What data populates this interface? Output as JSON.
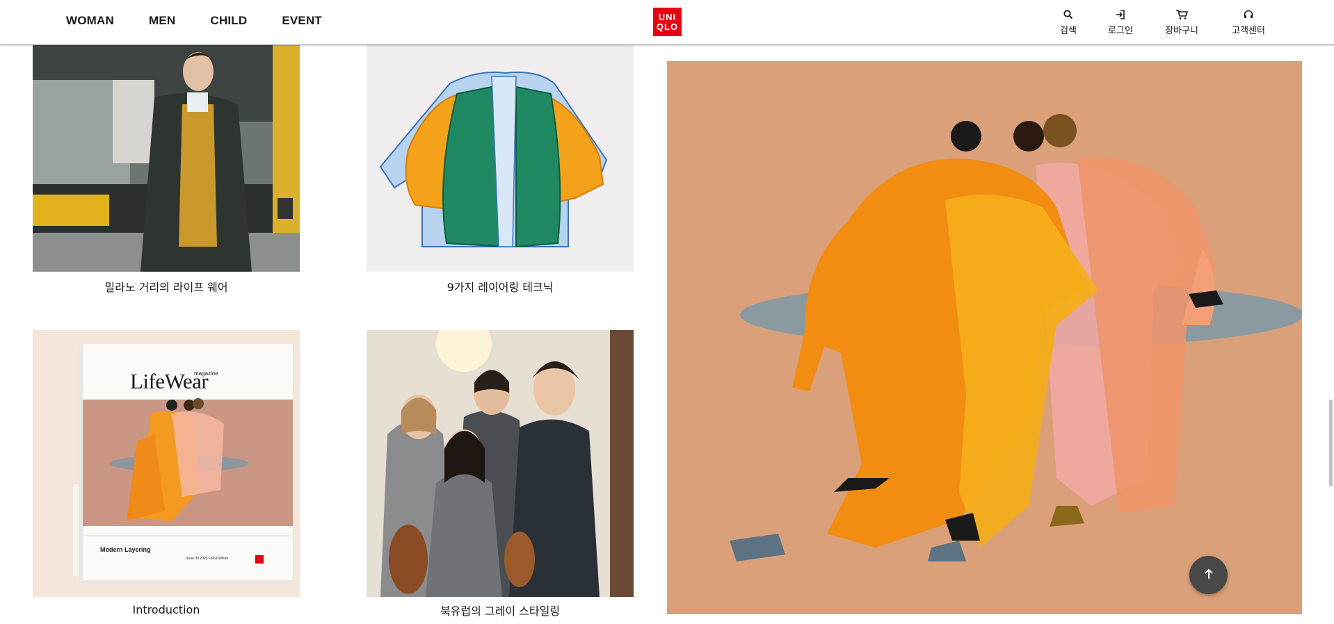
{
  "header": {
    "nav": [
      "WOMAN",
      "MEN",
      "CHILD",
      "EVENT"
    ],
    "logo_lines": [
      "UNI",
      "QLO"
    ],
    "utilities": {
      "search": "검색",
      "login": "로그인",
      "cart": "장바구니",
      "support": "고객센터"
    }
  },
  "tiles": {
    "milan": {
      "caption": "밀라노 거리의 라이프 웨어",
      "icon": "photo-street-man"
    },
    "layering": {
      "caption": "9가지 레이어링 테크닉",
      "icon": "illustration-jacket-vest"
    },
    "introduction": {
      "caption": "Introduction",
      "magazine_brand": "LifeWear",
      "magazine_word": "magazine",
      "magazine_title": "Modern Layering",
      "magazine_issue": "Issue 09 2023 Fall & Winter"
    },
    "grey": {
      "caption": "북유럽의 그레이 스타일링",
      "icon": "photo-musicians"
    },
    "hero": {
      "icon": "illustration-four-figures"
    }
  },
  "colors": {
    "brand_red": "#e60012",
    "hero_bg": "#d9a07a",
    "intro_bg": "#f4e6da",
    "layering_bg": "#f0eeee"
  },
  "controls": {
    "scroll_top_icon": "arrow-up-icon"
  }
}
